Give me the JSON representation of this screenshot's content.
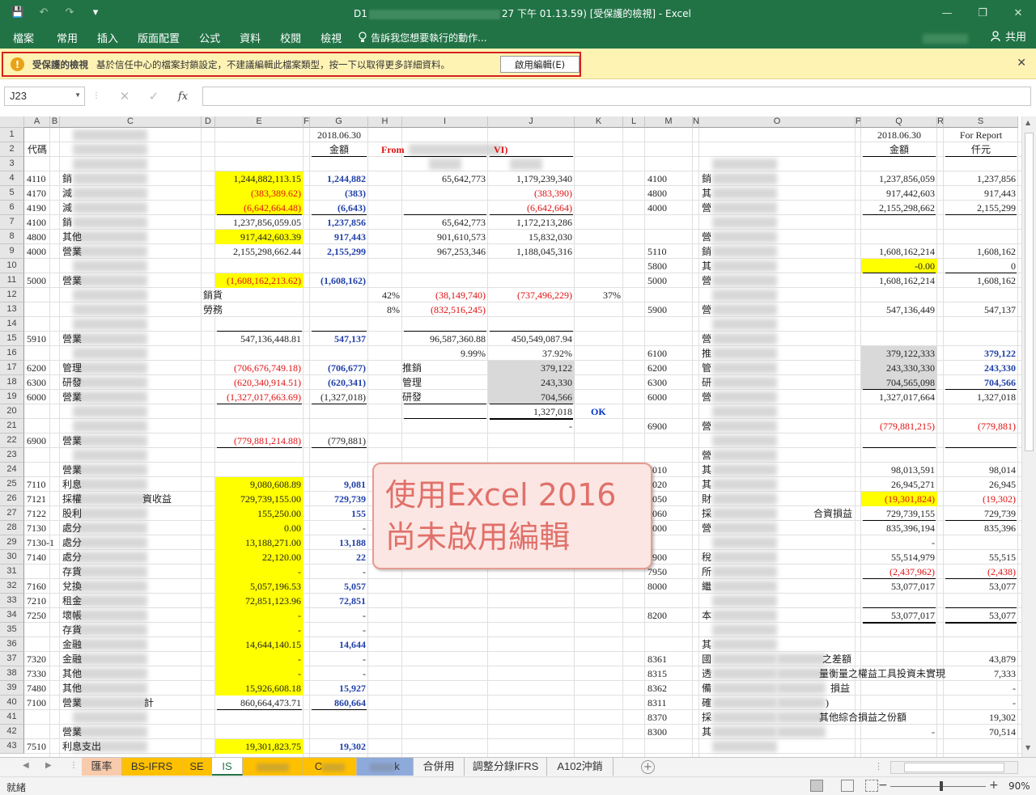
{
  "window": {
    "title_prefix": "D1",
    "title_suffix": "27 下午 01.13.59)  [受保護的檢視] - Excel",
    "controls": [
      "—",
      "❐",
      "✕"
    ]
  },
  "qat": {
    "save_icon": "💾",
    "undo_icon": "↶",
    "redo_icon": "↷",
    "more_icon": "▾"
  },
  "ribbon": {
    "tabs": [
      "檔案",
      "常用",
      "插入",
      "版面配置",
      "公式",
      "資料",
      "校閱",
      "檢視"
    ],
    "tell_me": "告訴我您想要執行的動作...",
    "share": "共用"
  },
  "protected_view": {
    "title": "受保護的檢視",
    "message": "基於信任中心的檔案封鎖設定，不建議編輯此檔案類型，按一下以取得更多詳細資料。",
    "enable_button": "啟用編輯(E)",
    "close": "✕"
  },
  "formula_bar": {
    "name_box": "J23",
    "cancel": "✕",
    "enter": "✓",
    "fx": "fx",
    "value": ""
  },
  "columns": [
    "A",
    "B",
    "C",
    "D",
    "E",
    "F",
    "G",
    "H",
    "I",
    "J",
    "K",
    "L",
    "M",
    "N",
    "O",
    "P",
    "Q",
    "R",
    "S"
  ],
  "rows": [
    "1",
    "2",
    "3",
    "4",
    "5",
    "6",
    "7",
    "8",
    "9",
    "10",
    "11",
    "12",
    "13",
    "14",
    "15",
    "16",
    "17",
    "18",
    "19",
    "20",
    "21",
    "22",
    "23",
    "24",
    "25",
    "26",
    "27",
    "28",
    "29",
    "30",
    "31",
    "32",
    "33",
    "34",
    "35",
    "36",
    "37",
    "38",
    "39",
    "40",
    "41",
    "42",
    "43"
  ],
  "cells": {
    "g1": "2018.06.30",
    "g2": "金額",
    "a2": "代碼",
    "h2": "From",
    "h2b": "VI)",
    "q1": "2018.06.30",
    "q2": "金額",
    "s1": "For Report",
    "s2": "仟元",
    "a4": "4110",
    "c4": "銷",
    "e4": "1,244,882,113.15",
    "g4": "1,244,882",
    "i4": "65,642,773",
    "j4": "1,179,239,340",
    "m4": "4100",
    "o4": "銷",
    "q4": "1,237,856,059",
    "s4": "1,237,856",
    "a5": "4170",
    "c5": "減",
    "e5": "(383,389.62)",
    "g5": "(383)",
    "j5": "(383,390)",
    "m5": "4800",
    "o5": "其",
    "q5": "917,442,603",
    "s5": "917,443",
    "a6": "4190",
    "c6": "減",
    "e6": "(6,642,664.48)",
    "g6": "(6,643)",
    "j6": "(6,642,664)",
    "m6": "4000",
    "o6": "營",
    "q6": "2,155,298,662",
    "s6": "2,155,299",
    "a7": "4100",
    "c7": "銷",
    "e7": "1,237,856,059.05",
    "g7": "1,237,856",
    "i7": "65,642,773",
    "j7": "1,172,213,286",
    "a8": "4800",
    "c8": "其他",
    "e8": "917,442,603.39",
    "g8": "917,443",
    "i8": "901,610,573",
    "j8": "15,832,030",
    "o8": "營",
    "a9": "4000",
    "c9": "營業",
    "e9": "2,155,298,662.44",
    "g9": "2,155,299",
    "i9": "967,253,346",
    "j9": "1,188,045,316",
    "m9": "5110",
    "o9": "銷",
    "q9": "1,608,162,214",
    "s9": "1,608,162",
    "m10": "5800",
    "o10": "其",
    "q10": "-0.00",
    "s10": "0",
    "a11": "5000",
    "c11": "營業",
    "e11": "(1,608,162,213.62)",
    "g11": "(1,608,162)",
    "m11": "5000",
    "o11": "營",
    "q11": "1,608,162,214",
    "s11": "1,608,162",
    "d12": "銷貨",
    "h12": "42%",
    "i12": "(38,149,740)",
    "j12": "(737,496,229)",
    "k12": "37%",
    "d13": "勞務",
    "h13": "8%",
    "i13": "(832,516,245)",
    "m13": "5900",
    "o13": "營",
    "q13": "547,136,449",
    "s13": "547,137",
    "a15": "5910",
    "c15": "營業",
    "e15": "547,136,448.81",
    "g15": "547,137",
    "i15": "96,587,360.88",
    "j15": "450,549,087.94",
    "o15": "營",
    "i16": "9.99%",
    "j16": "37.92%",
    "m16": "6100",
    "o16": "推",
    "q16": "379,122,333",
    "s16": "379,122",
    "a17": "6200",
    "c17": "管理",
    "e17": "(706,676,749.18)",
    "g17": "(706,677)",
    "h17": "推銷",
    "j17": "379,122",
    "m17": "6200",
    "o17": "管",
    "q17": "243,330,330",
    "s17": "243,330",
    "a18": "6300",
    "c18": "研發",
    "e18": "(620,340,914.51)",
    "g18": "(620,341)",
    "h18": "管理",
    "j18": "243,330",
    "m18": "6300",
    "o18": "研",
    "q18": "704,565,098",
    "s18": "704,566",
    "a19": "6000",
    "c19": "營業",
    "e19": "(1,327,017,663.69)",
    "g19": "(1,327,018)",
    "h19": "研發",
    "j19": "704,566",
    "m19": "6000",
    "o19": "營",
    "q19": "1,327,017,664",
    "s19": "1,327,018",
    "j20": "1,327,018",
    "k20": "OK",
    "j21": "-",
    "m21": "6900",
    "o21": "營",
    "q21": "(779,881,215)",
    "s21": "(779,881)",
    "a22": "6900",
    "c22": "營業",
    "e22": "(779,881,214.88)",
    "g22": "(779,881)",
    "o23": "營",
    "c24": "營業",
    "m24": "7010",
    "o24": "其",
    "q24": "98,013,591",
    "s24": "98,014",
    "a25": "7110",
    "c25": "利息",
    "e25": "9,080,608.89",
    "g25": "9,081",
    "m25": "7020",
    "o25": "其",
    "q25": "26,945,271",
    "s25": "26,945",
    "a26": "7121",
    "c26": "採權",
    "c26b": "資收益",
    "e26": "729,739,155.00",
    "g26": "729,739",
    "m26": "7050",
    "o26": "財",
    "q26": "(19,301,824)",
    "s26": "(19,302)",
    "a27": "7122",
    "c27": "股利",
    "e27": "155,250.00",
    "g27": "155",
    "m27": "7060",
    "o27": "採",
    "o27b": "合資損益",
    "q27": "729,739,155",
    "s27": "729,739",
    "a28": "7130",
    "c28": "處分",
    "e28": "0.00",
    "g28": "-",
    "m28": "7000",
    "o28": "營",
    "q28": "835,396,194",
    "s28": "835,396",
    "a29": "7130-1",
    "c29": "處分",
    "e29": "13,188,271.00",
    "g29": "13,188",
    "q29": "-",
    "a30": "7140",
    "c30": "處分",
    "e30": "22,120.00",
    "g30": "22",
    "m30": "7900",
    "o30": "稅",
    "q30": "55,514,979",
    "s30": "55,515",
    "c31": "存貨",
    "e31": "-",
    "g31": "-",
    "m31": "7950",
    "o31": "所",
    "q31": "(2,437,962)",
    "s31": "(2,438)",
    "a32": "7160",
    "c32": "兌換",
    "e32": "5,057,196.53",
    "g32": "5,057",
    "m32": "8000",
    "o32": "繼",
    "q32": "53,077,017",
    "s32": "53,077",
    "a33": "7210",
    "c33": "租金",
    "e33": "72,851,123.96",
    "g33": "72,851",
    "a34": "7250",
    "c34": "壞帳",
    "e34": "-",
    "g34": "-",
    "m34": "8200",
    "o34": "本",
    "q34": "53,077,017",
    "s34": "53,077",
    "c35": "存貨",
    "e35": "-",
    "g35": "-",
    "c36": "金融",
    "e36": "14,644,140.15",
    "g36": "14,644",
    "o36": "其",
    "a37": "7320",
    "c37": "金融",
    "e37": "-",
    "g37": "-",
    "m37": "8361",
    "o37": "國",
    "o37b": "之差額",
    "s37": "43,879",
    "a38": "7330",
    "c38": "其他",
    "e38": "-",
    "g38": "-",
    "m38": "8315",
    "o38": "透",
    "o38b": "量衡量之權益工具投資未實現",
    "s38": "7,333",
    "a39": "7480",
    "c39": "其他",
    "e39": "15,926,608.18",
    "g39": "15,927",
    "m39": "8362",
    "o39": "備",
    "o39b": "損益",
    "s39": "-",
    "a40": "7100",
    "c40": "營業",
    "c40b": "計",
    "e40": "860,664,473.71",
    "g40": "860,664",
    "m40": "8311",
    "o40": "確",
    "o40b": ")",
    "s40": "-",
    "m41": "8370",
    "o41": "採",
    "o41b": "其他綜合損益之份額",
    "s41": "19,302",
    "c42": "營業",
    "m42": "8300",
    "o42": "其",
    "q42": "-",
    "s42": "70,514",
    "a43": "7510",
    "c43": "利息支出",
    "e43": "19,301,823.75",
    "g43": "19,302"
  },
  "annotation": {
    "line1": "使用Excel 2016",
    "line2": "尚未啟用編輯"
  },
  "sheet_tabs": [
    "匯率",
    "BS-IFRS",
    "SE",
    "IS",
    "",
    "C",
    "k",
    "合併用",
    "調整分錄IFRS",
    "A102沖銷"
  ],
  "tab_nav": {
    "prev": "◀",
    "next": "▶",
    "add": "+",
    "dots": "⋮"
  },
  "status": {
    "ready": "就緒",
    "zoom": "90%",
    "minus": "−",
    "plus": "+"
  },
  "colors": {
    "excel_green": "#217346",
    "highlight_yellow": "#ffff00",
    "negative_red": "#e01010",
    "link_blue": "#1f3fa8",
    "annotation_text": "#e1706a"
  }
}
